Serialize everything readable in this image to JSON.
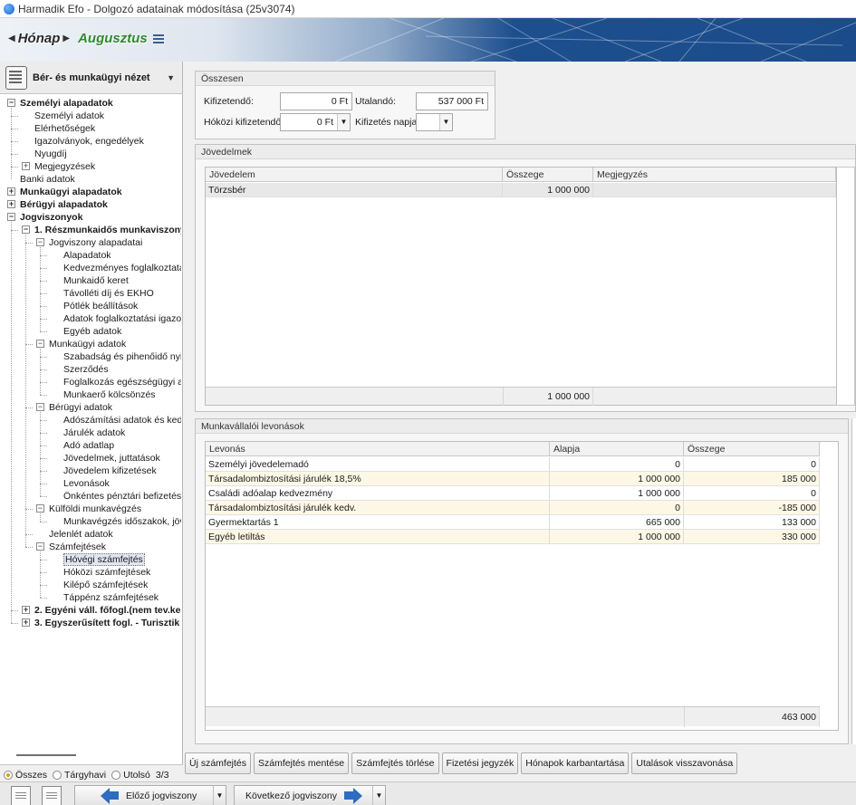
{
  "window": {
    "title": "Harmadik Efo - Dolgozó adatainak módosítása (25v3074)"
  },
  "period": {
    "label": "Hónap",
    "value": "Augusztus"
  },
  "sidebar": {
    "view_label": "Bér- és munkaügyi nézet",
    "tree": [
      {
        "label": "Személyi alapadatok",
        "level": 0,
        "bold": true,
        "exp": "-",
        "row": 0
      },
      {
        "label": "Személyi adatok",
        "level": 1,
        "row": 1
      },
      {
        "label": "Elérhetőségek",
        "level": 1,
        "row": 2
      },
      {
        "label": "Igazolványok, engedélyek",
        "level": 1,
        "row": 3
      },
      {
        "label": "Nyugdíj",
        "level": 1,
        "row": 4
      },
      {
        "label": "Megjegyzések",
        "level": 1,
        "exp": "+",
        "row": 5
      },
      {
        "label": "Banki adatok",
        "level": 0,
        "row": 6
      },
      {
        "label": "Munkaügyi alapadatok",
        "level": 0,
        "bold": true,
        "exp": "+",
        "row": 7
      },
      {
        "label": "Bérügyi alapadatok",
        "level": 0,
        "bold": true,
        "exp": "+",
        "row": 8
      },
      {
        "label": "Jogviszonyok",
        "level": 0,
        "bold": true,
        "exp": "-",
        "row": 9
      },
      {
        "label": "1. Részmunkaidős munkaviszony",
        "level": 1,
        "bold": true,
        "exp": "-",
        "row": 10
      },
      {
        "label": "Jogviszony alapadatai",
        "level": 2,
        "exp": "-",
        "row": 11
      },
      {
        "label": "Alapadatok",
        "level": 3,
        "row": 12
      },
      {
        "label": "Kedvezményes foglalkoztatás",
        "level": 3,
        "row": 13
      },
      {
        "label": "Munkaidő keret",
        "level": 3,
        "row": 14
      },
      {
        "label": "Távolléti díj és EKHO",
        "level": 3,
        "row": 15
      },
      {
        "label": "Pótlék beállítások",
        "level": 3,
        "row": 16
      },
      {
        "label": "Adatok foglalkoztatási igazolás",
        "level": 3,
        "row": 17
      },
      {
        "label": "Egyéb adatok",
        "level": 3,
        "row": 18
      },
      {
        "label": "Munkaügyi adatok",
        "level": 2,
        "exp": "-",
        "row": 19
      },
      {
        "label": "Szabadság és pihenőidő nyilvá",
        "level": 3,
        "row": 20
      },
      {
        "label": "Szerződés",
        "level": 3,
        "row": 21
      },
      {
        "label": "Foglalkozás egészségügyi ada",
        "level": 3,
        "row": 22
      },
      {
        "label": "Munkaerő kölcsönzés",
        "level": 3,
        "row": 23
      },
      {
        "label": "Bérügyi adatok",
        "level": 2,
        "exp": "-",
        "row": 24
      },
      {
        "label": "Adószámítási adatok és kedve",
        "level": 3,
        "row": 25
      },
      {
        "label": "Járulék adatok",
        "level": 3,
        "row": 26
      },
      {
        "label": "Adó adatlap",
        "level": 3,
        "row": 27
      },
      {
        "label": "Jövedelmek, juttatások",
        "level": 3,
        "row": 28
      },
      {
        "label": "Jövedelem kifizetések",
        "level": 3,
        "row": 29
      },
      {
        "label": "Levonások",
        "level": 3,
        "row": 30
      },
      {
        "label": "Önkéntes pénztári befizetések",
        "level": 3,
        "row": 31
      },
      {
        "label": "Külföldi munkavégzés",
        "level": 2,
        "exp": "-",
        "row": 32
      },
      {
        "label": "Munkavégzés időszakok, jöved",
        "level": 3,
        "row": 33
      },
      {
        "label": "Jelenlét adatok",
        "level": 2,
        "row": 34
      },
      {
        "label": "Számfejtések",
        "level": 2,
        "exp": "-",
        "row": 35
      },
      {
        "label": "Hóvégi számfejtés",
        "level": 3,
        "selected": true,
        "row": 36
      },
      {
        "label": "Hóközi számfejtések",
        "level": 3,
        "row": 37
      },
      {
        "label": "Kilépő számfejtések",
        "level": 3,
        "row": 38
      },
      {
        "label": "Táppénz számfejtések",
        "level": 3,
        "row": 39
      },
      {
        "label": "2. Egyéni váll. főfogl.(nem tev.ke",
        "level": 1,
        "bold": true,
        "exp": "+",
        "row": 40
      },
      {
        "label": "3. Egyszerűsített fogl. - Turisztik",
        "level": 1,
        "bold": true,
        "exp": "+",
        "row": 41
      }
    ],
    "filter": {
      "options": [
        "Összes",
        "Tárgyhavi",
        "Utolsó"
      ],
      "selected": "Összes",
      "count": "3/3"
    }
  },
  "summary": {
    "title": "Összesen",
    "kifizetendo_label": "Kifizetendő:",
    "kifizetendo_value": "0 Ft",
    "utalando_label": "Utalandó:",
    "utalando_value": "537 000 Ft",
    "hokozi_label": "Hóközi kifizetendő:",
    "hokozi_value": "0 Ft",
    "kifizetes_napja_label": "Kifizetés napja",
    "kifizetes_napja_value": ""
  },
  "income": {
    "title": "Jövedelmek",
    "columns": [
      "Jövedelem",
      "Összege",
      "Megjegyzés"
    ],
    "rows": [
      [
        "Törzsbér",
        "1 000 000",
        ""
      ]
    ],
    "total": "1 000 000"
  },
  "deductions": {
    "title": "Munkavállalói levonások",
    "columns": [
      "Levonás",
      "Alapja",
      "Összege"
    ],
    "rows": [
      [
        "Személyi jövedelemadó",
        "0",
        "0"
      ],
      [
        "Társadalombiztosítási járulék 18,5%",
        "1 000 000",
        "185 000"
      ],
      [
        "Családi adóalap kedvezmény",
        "1 000 000",
        "0"
      ],
      [
        "Társadalombiztosítási járulék kedv.",
        "0",
        "-185 000"
      ],
      [
        "Gyermektartás 1",
        "665 000",
        "133 000"
      ],
      [
        "Egyéb letiltás",
        "1 000 000",
        "330 000"
      ]
    ],
    "total": "463 000"
  },
  "actions": [
    "Új számfejtés",
    "Számfejtés mentése",
    "Számfejtés törlése",
    "Fizetési jegyzék",
    "Hónapok karbantartása",
    "Utalások visszavonása"
  ],
  "bottom": {
    "prev_label": "Előző jogviszony",
    "next_label": "Következő jogviszony"
  }
}
